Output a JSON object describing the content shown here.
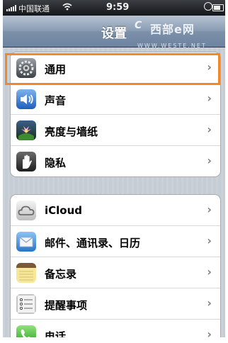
{
  "status_bar": {
    "carrier": "中国联通",
    "wifi_icon": "wifi-icon",
    "time": "9:59"
  },
  "nav": {
    "title": "设置"
  },
  "watermark": {
    "logo": "C",
    "text": "西部e网",
    "url": "WWW.WESTE.NET"
  },
  "groups": [
    {
      "items": [
        {
          "label": "通用",
          "icon": "gear-icon",
          "highlighted": true
        },
        {
          "label": "声音",
          "icon": "speaker-icon"
        },
        {
          "label": "亮度与墙纸",
          "icon": "flower-icon"
        },
        {
          "label": "隐私",
          "icon": "hand-icon"
        }
      ]
    },
    {
      "items": [
        {
          "label": "iCloud",
          "icon": "cloud-icon"
        },
        {
          "label": "邮件、通讯录、日历",
          "icon": "mail-icon"
        },
        {
          "label": "备忘录",
          "icon": "notes-icon"
        },
        {
          "label": "提醒事项",
          "icon": "reminders-icon"
        },
        {
          "label": "电话",
          "icon": "phone-icon"
        }
      ]
    }
  ],
  "chevron": "›",
  "colors": {
    "highlight": "#ee8a2d",
    "nav_top": "#b6c3d3",
    "nav_bottom": "#6d83a0",
    "background": "#c5ccd4"
  }
}
